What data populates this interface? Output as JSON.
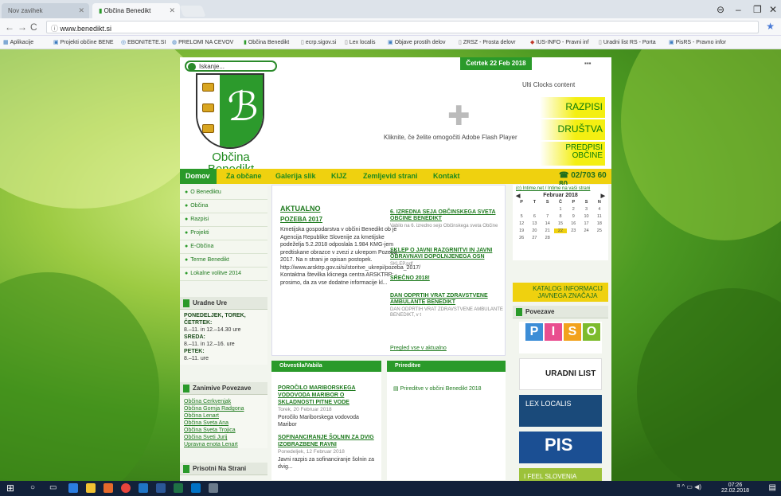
{
  "browser": {
    "tabs": [
      {
        "label": "Nov zavihek"
      },
      {
        "label": "Občina Benedikt"
      }
    ],
    "url": "www.benedikt.si",
    "bookmarks": [
      "Aplikacije",
      "Projekti občine BENE",
      "EBONITETE.SI",
      "PRELOMI NA CEVOV",
      "Občina Benedikt",
      "ecrp.sigov.si",
      "Lex localis",
      "Objave prostih delov",
      "ZRSZ - Prosta delovr",
      "IUS-INFO - Pravni inf",
      "Uradni list RS - Porta",
      "PisRS - Pravno infor"
    ]
  },
  "site": {
    "search_value": "Iskanje...",
    "logo_text": [
      "Občina",
      "Benedikt"
    ],
    "date": "Četrtek 22 Feb 2018",
    "ulti": "Ulti Clocks content",
    "flash": "Kliknite, če želite omogočiti Adobe Flash Player",
    "quick_links": [
      "RAZPISI",
      "DRUŠTVA",
      "PREDPISI OBČINE"
    ],
    "nav": {
      "items": [
        "Domov",
        "Za občane",
        "Galerija slik",
        "KIJZ",
        "Zemljevid strani",
        "Kontakt"
      ],
      "phone": "02/703 60 80"
    },
    "menu": [
      "O Benediktu",
      "Občina",
      "Razpisi",
      "Projekti",
      "E-Občina",
      "Terme Benedikt",
      "Lokalne volitve 2014"
    ],
    "hours": {
      "title": "Uradne Ure",
      "lines": [
        {
          "day": "PONEDELJEK, TOREK, ČETRTEK:",
          "time": "8.–11. in 12.–14.30 ure"
        },
        {
          "day": "SREDA:",
          "time": "8.–11. in 12.–16. ure"
        },
        {
          "day": "PETEK:",
          "time": "8.–11. ure"
        }
      ]
    },
    "links": {
      "title": "Zanimive Povezave",
      "items": [
        "Občina Cerkvenjak",
        "Občina Gornja Radgona",
        "Občina Lenart",
        "Občina Sveta Ana",
        "Občina Sveta Trojica",
        "Občina Sveti Jurij",
        "Upravna enota Lenart"
      ]
    },
    "present_title": "Prisotni Na Strani",
    "aktualno": {
      "title": "AKTUALNO",
      "head_title": "POZEBA 2017",
      "head_body": "Kmetijska gospodarstva v občini Benedikt ob je Agencija Republike Slovenije za kmetijske podeželja 5.2.2018 odposlala 1.984 KMG-jem predtiskane obrazce v zvezi z ukrepom Pozeba 2017. Na n strani je opisan postopek. http://www.arsktrp.gov.si/si/storitve_ukrepi/pozeba_2017/ Kontaktna številka klicnega centra ARSKTRP: - prosimo, da za vse dodatne informacije kl...",
      "items": [
        {
          "title": "6. IZREDNA SEJA OBČINSKEGA SVETA OBČINE BENEDIKT",
          "sub": "Vabilo na 6. izredno sejo Občinskega sveta Občine"
        },
        {
          "title": "SKLEP O JAVNI RAZGRNITVI IN JAVNI OBRAVNAVI DOPOLNJENEGA OSN",
          "sub": "SKLEP.pdf"
        },
        {
          "title": "SREČNO 2018!",
          "sub": ""
        },
        {
          "title": "DAN ODPRTIH VRAT ZDRAVSTVENE AMBULANTE BENEDIKT",
          "sub": "DAN ODPRTIH VRAT ZDRAVSTVENE AMBULANTE BENEDIKT, v t"
        }
      ],
      "more": "Pregled vse v aktualno"
    },
    "calendar": {
      "top": "(c) Intime.net / Intime na vaši strani",
      "month": "Februar 2018",
      "dow": [
        "P",
        "T",
        "S",
        "Č",
        "P",
        "S",
        "N"
      ],
      "days": [
        "",
        "",
        "",
        "1",
        "2",
        "3",
        "4",
        "5",
        "6",
        "7",
        "8",
        "9",
        "10",
        "11",
        "12",
        "13",
        "14",
        "15",
        "16",
        "17",
        "18",
        "19",
        "20",
        "21",
        "22",
        "23",
        "24",
        "25",
        "26",
        "27",
        "28",
        "",
        "",
        "",
        ""
      ],
      "today": "22"
    },
    "katalog": "KATALOG INFORMACIJ JAVNEGA ZNAČAJA",
    "povezave_title": "Povezave",
    "banners": {
      "piso": [
        "P",
        "I",
        "S",
        "O"
      ],
      "uradni": "URADNI LIST",
      "lex": "LEX LOCALIS",
      "pis": "PIS",
      "ifeel": "I FEEL SLOVENIA"
    },
    "obvestila": {
      "title": "Obvestila/Vabila",
      "items": [
        {
          "title": "POROČILO MARIBORSKEGA VODOVODA MARIBOR O SKLADNOSTI PITNE VODE",
          "date": "Torek, 20 Februar 2018",
          "text": "Poročilo Mariborskega vodovoda Maribor"
        },
        {
          "title": "SOFINANCIRANJE ŠOLNIN ZA DVIG IZOBRAZBENE RAVNI",
          "date": "Ponedeljek, 12 Februar 2018",
          "text": "Javni razpis za sofinanciranje šolnin za dvig..."
        }
      ]
    },
    "prireditve": {
      "title": "Prireditve",
      "item": "Prireditve v občini Benedikt 2018"
    }
  },
  "taskbar": {
    "time": "07:26",
    "date": "22.02.2018"
  }
}
